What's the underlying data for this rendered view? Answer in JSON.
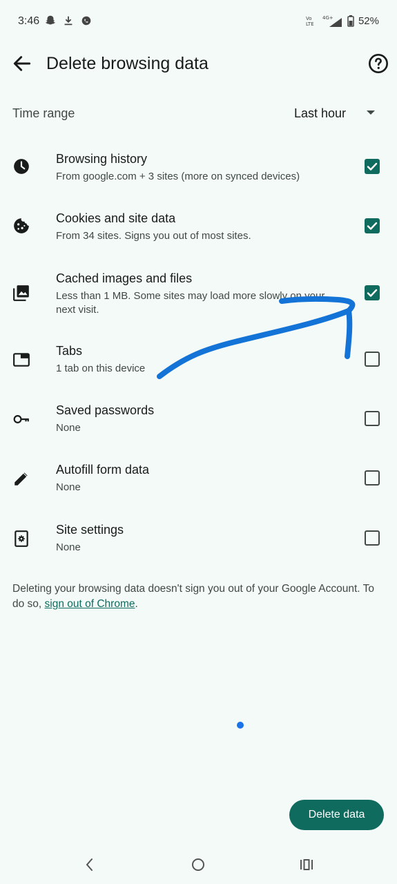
{
  "status_bar": {
    "time": "3:46",
    "battery": "52%",
    "network_top": "Vo LTE",
    "network_4g": "4G+",
    "icons": [
      "snapchat-icon",
      "download-icon",
      "whatsapp-icon",
      "volte-icon",
      "signal-icon",
      "battery-icon"
    ]
  },
  "app_bar": {
    "title": "Delete browsing data",
    "back_icon": "arrow-back-icon",
    "help_icon": "help-icon"
  },
  "time_range": {
    "label": "Time range",
    "value": "Last hour"
  },
  "items": [
    {
      "title": "Browsing history",
      "subtitle": "From google.com + 3 sites (more on synced devices)",
      "checked": true,
      "icon": "clock-icon"
    },
    {
      "title": "Cookies and site data",
      "subtitle": "From 34 sites. Signs you out of most sites.",
      "checked": true,
      "icon": "cookie-icon"
    },
    {
      "title": "Cached images and files",
      "subtitle": "Less than 1 MB. Some sites may load more slowly on your next visit.",
      "checked": true,
      "icon": "images-icon"
    },
    {
      "title": "Tabs",
      "subtitle": "1 tab on this device",
      "checked": false,
      "icon": "tab-icon"
    },
    {
      "title": "Saved passwords",
      "subtitle": "None",
      "checked": false,
      "icon": "key-icon"
    },
    {
      "title": "Autofill form data",
      "subtitle": "None",
      "checked": false,
      "icon": "pencil-icon"
    },
    {
      "title": "Site settings",
      "subtitle": "None",
      "checked": false,
      "icon": "site-settings-icon"
    }
  ],
  "note": {
    "text": "Deleting your browsing data doesn't sign you out of your Google Account. To do so, ",
    "link": "sign out of Chrome",
    "end": "."
  },
  "delete_button": "Delete data",
  "colors": {
    "background": "#f3faf8",
    "accent": "#0f6b5e",
    "annotation": "#1473d6"
  }
}
